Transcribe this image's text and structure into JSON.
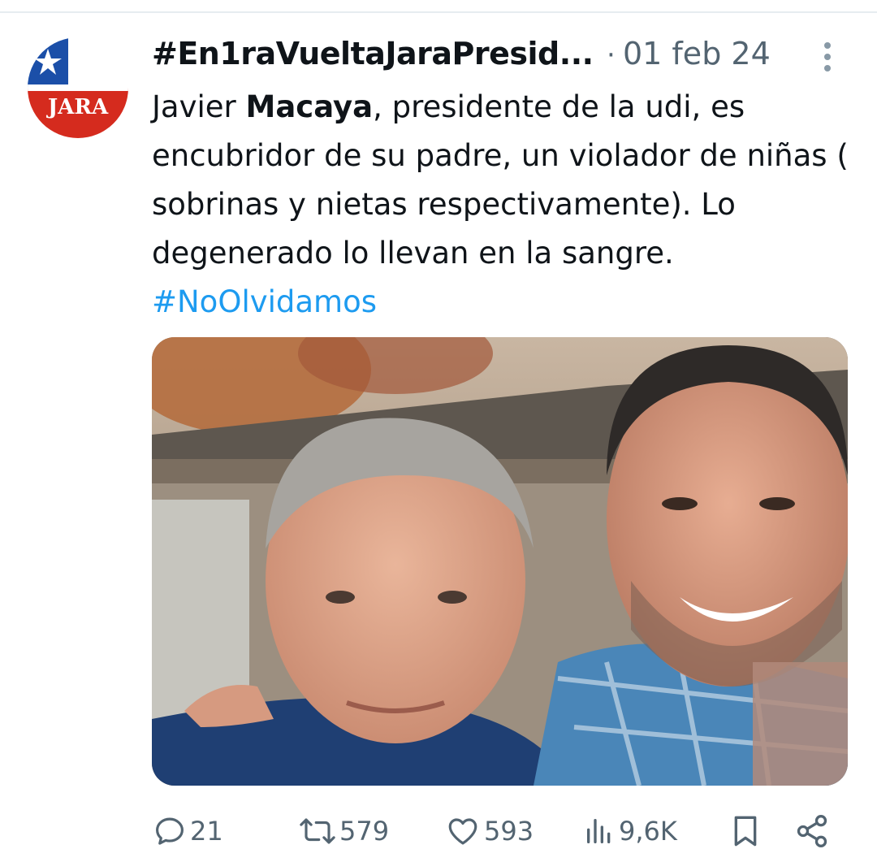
{
  "tweet": {
    "display_name": "#En1raVueltaJaraPresid...",
    "separator": "·",
    "date": "01 feb 24",
    "text_parts": [
      "Javier ",
      "Macaya",
      ", presidente de la udi, es encubridor de su padre, un violador de niñas ( sobrinas y nietas respectivamente). Lo degenerado lo llevan en la sangre. ",
      "#NoOlvidamos"
    ],
    "avatar": {
      "label": "JARA",
      "colors": {
        "blue": "#1b4fa8",
        "red": "#d52b1e",
        "white": "#ffffff"
      }
    },
    "hashtag_color": "#1d9bf0"
  },
  "actions": {
    "reply": {
      "icon": "reply-icon",
      "count": "21"
    },
    "retweet": {
      "icon": "retweet-icon",
      "count": "579"
    },
    "like": {
      "icon": "heart-icon",
      "count": "593"
    },
    "views": {
      "icon": "views-icon",
      "count": "9,6K"
    },
    "bookmark": {
      "icon": "bookmark-icon"
    },
    "share": {
      "icon": "share-icon"
    }
  }
}
